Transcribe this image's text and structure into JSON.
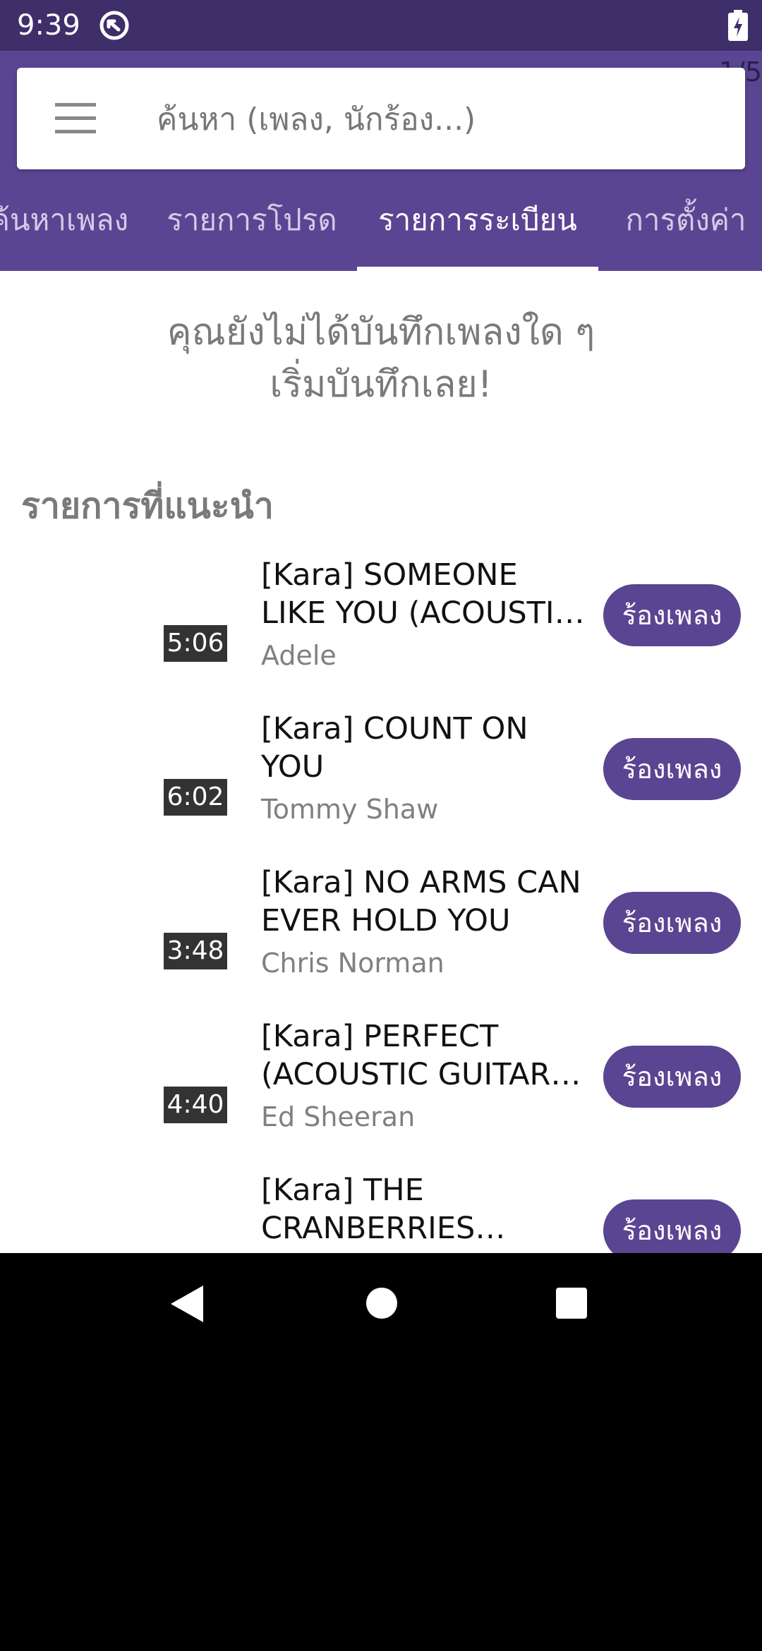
{
  "status_bar": {
    "time": "9:39",
    "icons": [
      "sync-icon",
      "battery-charging-icon"
    ]
  },
  "page_indicator": "1/5",
  "search": {
    "placeholder": "ค้นหา (เพลง, นักร้อง...)",
    "value": ""
  },
  "tabs": [
    {
      "label": "ค้นหาเพลง",
      "active": false
    },
    {
      "label": "รายการโปรด",
      "active": false
    },
    {
      "label": "รายการระเบียน",
      "active": true
    },
    {
      "label": "การตั้งค่า",
      "active": false
    }
  ],
  "empty_state": {
    "line1": "คุณยังไม่ได้บันทึกเพลงใด ๆ",
    "line2": "เริ่มบันทึกเลย!"
  },
  "recommended": {
    "title": "รายการที่แนะนำ",
    "button_label": "ร้องเพลง",
    "songs": [
      {
        "title": "[Kara] SOMEONE LIKE YOU (ACOUSTIC …",
        "artist": "Adele",
        "duration": "5:06"
      },
      {
        "title": "[Kara] COUNT ON YOU",
        "artist": "Tommy Shaw",
        "duration": "6:02"
      },
      {
        "title": "[Kara] NO ARMS CAN EVER HOLD YOU",
        "artist": "Chris Norman",
        "duration": "3:48"
      },
      {
        "title": "[Kara] PERFECT (ACOUSTIC GUITAR V…",
        "artist": "Ed Sheeran",
        "duration": "4:40"
      },
      {
        "title": "[Kara] THE CRANBERRIES (ACOU…",
        "artist": "",
        "duration": ""
      }
    ]
  },
  "colors": {
    "status_bar": "#3e2f6b",
    "app_bar": "#5a4592",
    "button": "#5a4592",
    "duration_badge": "#333333"
  },
  "nav_bar": {
    "icons": [
      "back-icon",
      "home-icon",
      "recents-icon"
    ]
  }
}
